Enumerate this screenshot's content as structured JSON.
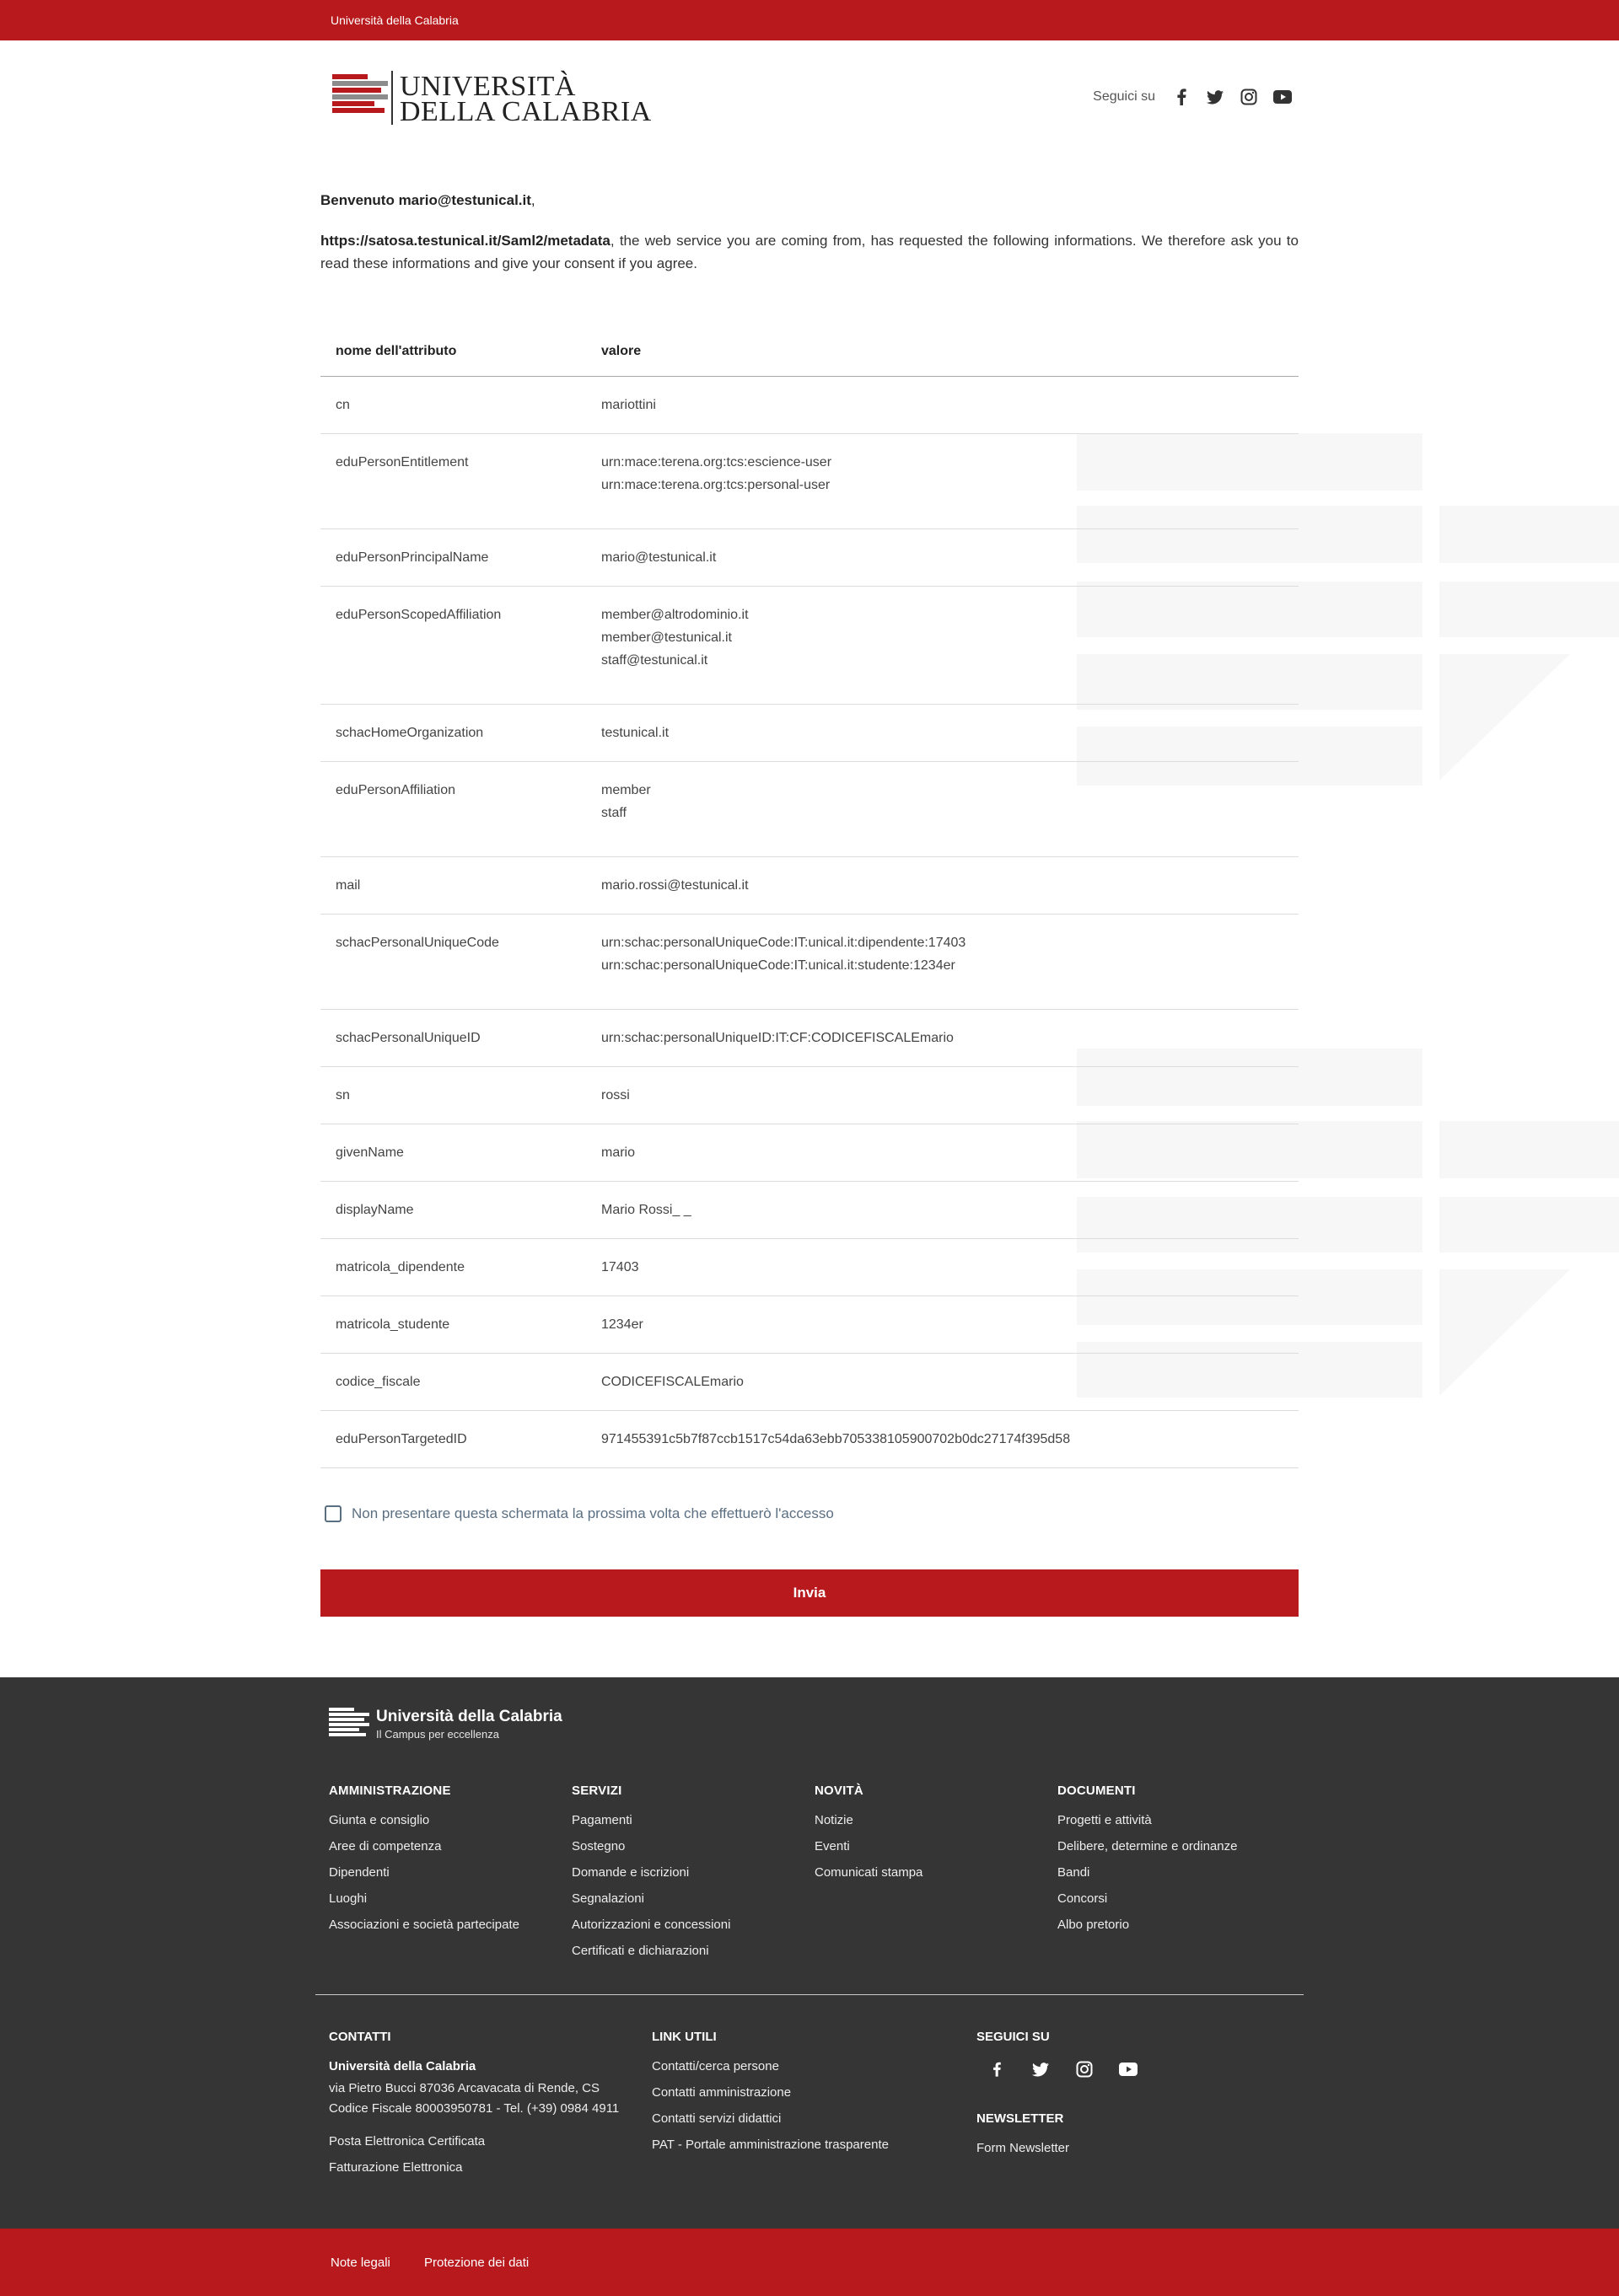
{
  "topbar": {
    "link": "Università della Calabria"
  },
  "logo": {
    "line1": "UNIVERSITÀ",
    "line2": "DELLA CALABRIA"
  },
  "header_social": {
    "label": "Seguici su",
    "icons": [
      "facebook-icon",
      "twitter-icon",
      "instagram-icon",
      "youtube-icon"
    ]
  },
  "consent_page": {
    "welcome_prefix": "Benvenuto ",
    "user": "mario@testunical.it",
    "welcome_suffix": ",",
    "sp_url": "https://satosa.testunical.it/Saml2/metadata",
    "intro_text": ", the web service you are coming from, has requested the following informations. We therefore ask you to read these informations and give your consent if you agree."
  },
  "table": {
    "headers": [
      "nome dell'attributo",
      "valore"
    ],
    "rows": [
      {
        "name": "cn",
        "values": [
          "mariottini"
        ]
      },
      {
        "name": "eduPersonEntitlement",
        "values": [
          "urn:mace:terena.org:tcs:escience-user",
          "urn:mace:terena.org:tcs:personal-user"
        ]
      },
      {
        "name": "eduPersonPrincipalName",
        "values": [
          "mario@testunical.it"
        ]
      },
      {
        "name": "eduPersonScopedAffiliation",
        "values": [
          "member@altrodominio.it",
          "member@testunical.it",
          "staff@testunical.it"
        ]
      },
      {
        "name": "schacHomeOrganization",
        "values": [
          "testunical.it"
        ]
      },
      {
        "name": "eduPersonAffiliation",
        "values": [
          "member",
          "staff"
        ]
      },
      {
        "name": "mail",
        "values": [
          "mario.rossi@testunical.it"
        ]
      },
      {
        "name": "schacPersonalUniqueCode",
        "values": [
          "urn:schac:personalUniqueCode:IT:unical.it:dipendente:17403",
          "urn:schac:personalUniqueCode:IT:unical.it:studente:1234er"
        ]
      },
      {
        "name": "schacPersonalUniqueID",
        "values": [
          "urn:schac:personalUniqueID:IT:CF:CODICEFISCALEmario"
        ]
      },
      {
        "name": "sn",
        "values": [
          "rossi"
        ]
      },
      {
        "name": "givenName",
        "values": [
          "mario"
        ]
      },
      {
        "name": "displayName",
        "values": [
          "Mario Rossi_ _"
        ]
      },
      {
        "name": "matricola_dipendente",
        "values": [
          "17403"
        ]
      },
      {
        "name": "matricola_studente",
        "values": [
          "1234er"
        ]
      },
      {
        "name": "codice_fiscale",
        "values": [
          "CODICEFISCALEmario"
        ]
      },
      {
        "name": "eduPersonTargetedID",
        "values": [
          "971455391c5b7f87ccb1517c54da63ebb705338105900702b0dc27174f395d58"
        ]
      }
    ]
  },
  "consent_checkbox": {
    "label": "Non presentare questa schermata la prossima volta che effettuerò l'accesso",
    "checked": false
  },
  "submit_label": "Invia",
  "footer": {
    "logo_title": "Università della Calabria",
    "logo_subtitle": "Il Campus per eccellenza",
    "columns": [
      {
        "title": "AMMINISTRAZIONE",
        "links": [
          "Giunta e consiglio",
          "Aree di competenza",
          "Dipendenti",
          "Luoghi",
          "Associazioni e società partecipate"
        ]
      },
      {
        "title": "SERVIZI",
        "links": [
          "Pagamenti",
          "Sostegno",
          "Domande e iscrizioni",
          "Segnalazioni",
          "Autorizzazioni e concessioni",
          "Certificati e dichiarazioni"
        ]
      },
      {
        "title": "NOVITÀ",
        "links": [
          "Notizie",
          "Eventi",
          "Comunicati stampa"
        ]
      },
      {
        "title": "DOCUMENTI",
        "links": [
          "Progetti e attività",
          "Delibere, determine e ordinanze",
          "Bandi",
          "Concorsi",
          "Albo pretorio"
        ]
      }
    ],
    "contacts": {
      "title": "CONTATTI",
      "org": "Università della Calabria",
      "address": "via Pietro Bucci 87036 Arcavacata di Rende, CS",
      "fiscal": "Codice Fiscale 80003950781 - Tel. (+39) 0984 4911",
      "links": [
        "Posta Elettronica Certificata",
        "Fatturazione Elettronica"
      ]
    },
    "useful_links": {
      "title": "LINK UTILI",
      "links": [
        "Contatti/cerca persone",
        "Contatti amministrazione",
        "Contatti servizi didattici",
        "PAT - Portale amministrazione trasparente"
      ]
    },
    "social": {
      "title": "SEGUICI SU",
      "icons": [
        "facebook-icon",
        "twitter-icon",
        "instagram-icon",
        "youtube-icon"
      ]
    },
    "newsletter": {
      "title": "NEWSLETTER",
      "link": "Form Newsletter"
    }
  },
  "bottombar": {
    "links": [
      "Note legali",
      "Protezione dei dati"
    ]
  },
  "colors": {
    "brand_red": "#b8191c",
    "footer_bg": "#353535",
    "text": "#333333",
    "muted_blue": "#5b6f82"
  }
}
